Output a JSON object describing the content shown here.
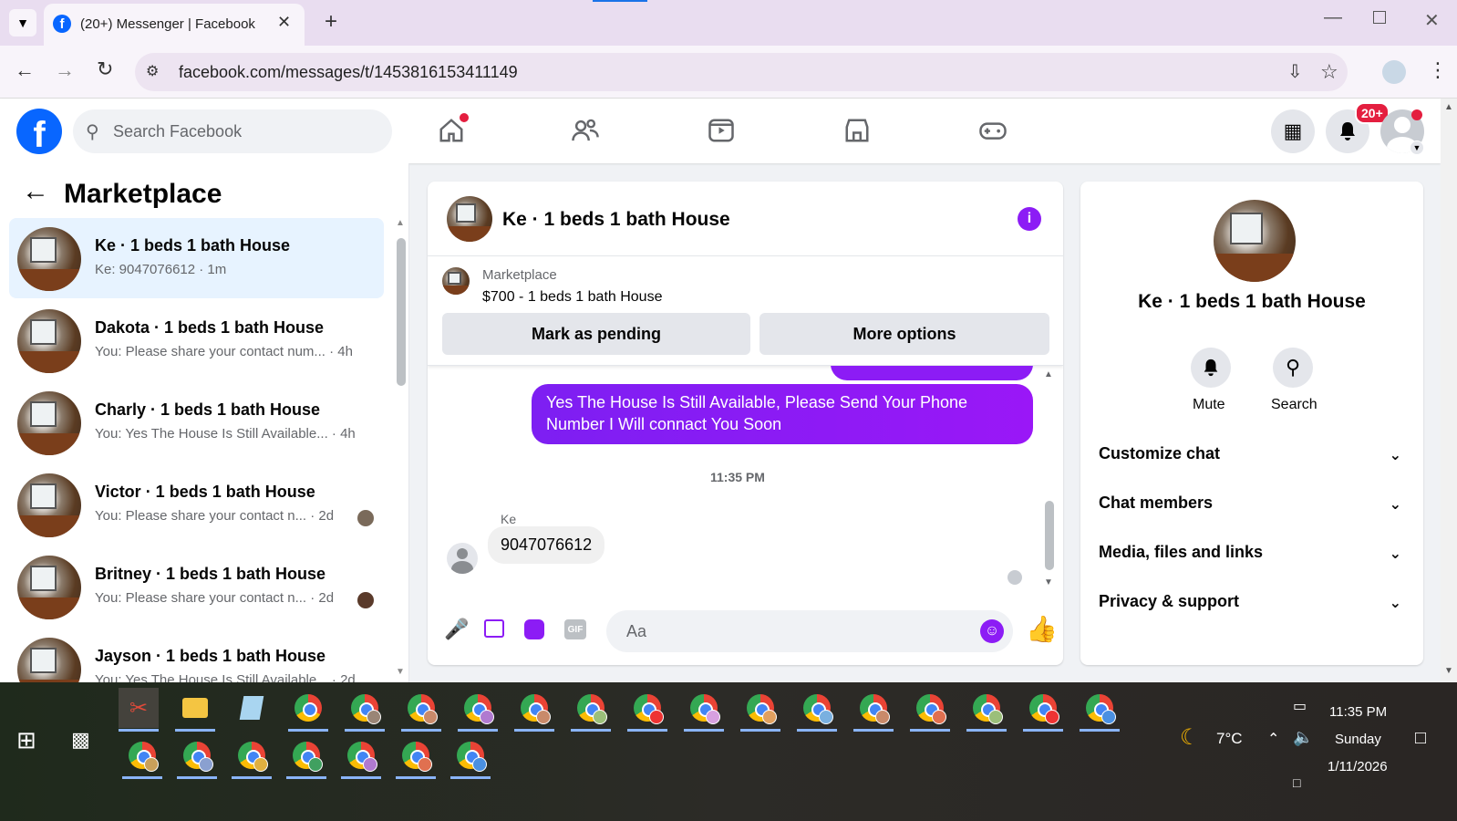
{
  "browser": {
    "tab_title": "(20+) Messenger | Facebook",
    "url": "facebook.com/messages/t/1453816153411149"
  },
  "header": {
    "search_placeholder": "Search Facebook",
    "notif_badge": "20+",
    "brand_color": "#0866ff"
  },
  "sidebar": {
    "title": "Marketplace",
    "conversations": [
      {
        "name": "Ke · 1 beds 1 bath House",
        "snippet": "Ke: 9047076612 · 1m",
        "active": true
      },
      {
        "name": "Dakota · 1 beds 1 bath House",
        "snippet": "You: Please share your contact num... · 4h"
      },
      {
        "name": "Charly · 1 beds 1 bath House",
        "snippet": "You: Yes The House Is Still Available... · 4h"
      },
      {
        "name": "Victor · 1 beds 1 bath House",
        "snippet": "You: Please share your contact n... · 2d"
      },
      {
        "name": "Britney · 1 beds 1 bath House",
        "snippet": "You: Please share your contact n... · 2d"
      },
      {
        "name": "Jayson · 1 beds 1 bath House",
        "snippet": "You: Yes The House Is Still Available... · 2d"
      }
    ]
  },
  "chat": {
    "title": "Ke · 1 beds 1 bath House",
    "listing_label": "Marketplace",
    "listing_price": "$700 - 1 beds 1 bath House",
    "mark_pending": "Mark as pending",
    "more_options": "More options",
    "outgoing_message": "Yes The House Is Still Available, Please Send Your Phone Number I Will connact You Soon",
    "timestamp": "11:35 PM",
    "sender": "Ke",
    "incoming_message": "9047076612",
    "composer_placeholder": "Aa",
    "accent_color": "#8c1cf5"
  },
  "info": {
    "title": "Ke · 1 beds 1 bath House",
    "mute": "Mute",
    "search": "Search",
    "sections": [
      "Customize chat",
      "Chat members",
      "Media, files and links",
      "Privacy & support"
    ]
  },
  "taskbar": {
    "weather": "7°C",
    "time": "11:35 PM",
    "day": "Sunday",
    "date": "1/11/2026"
  }
}
